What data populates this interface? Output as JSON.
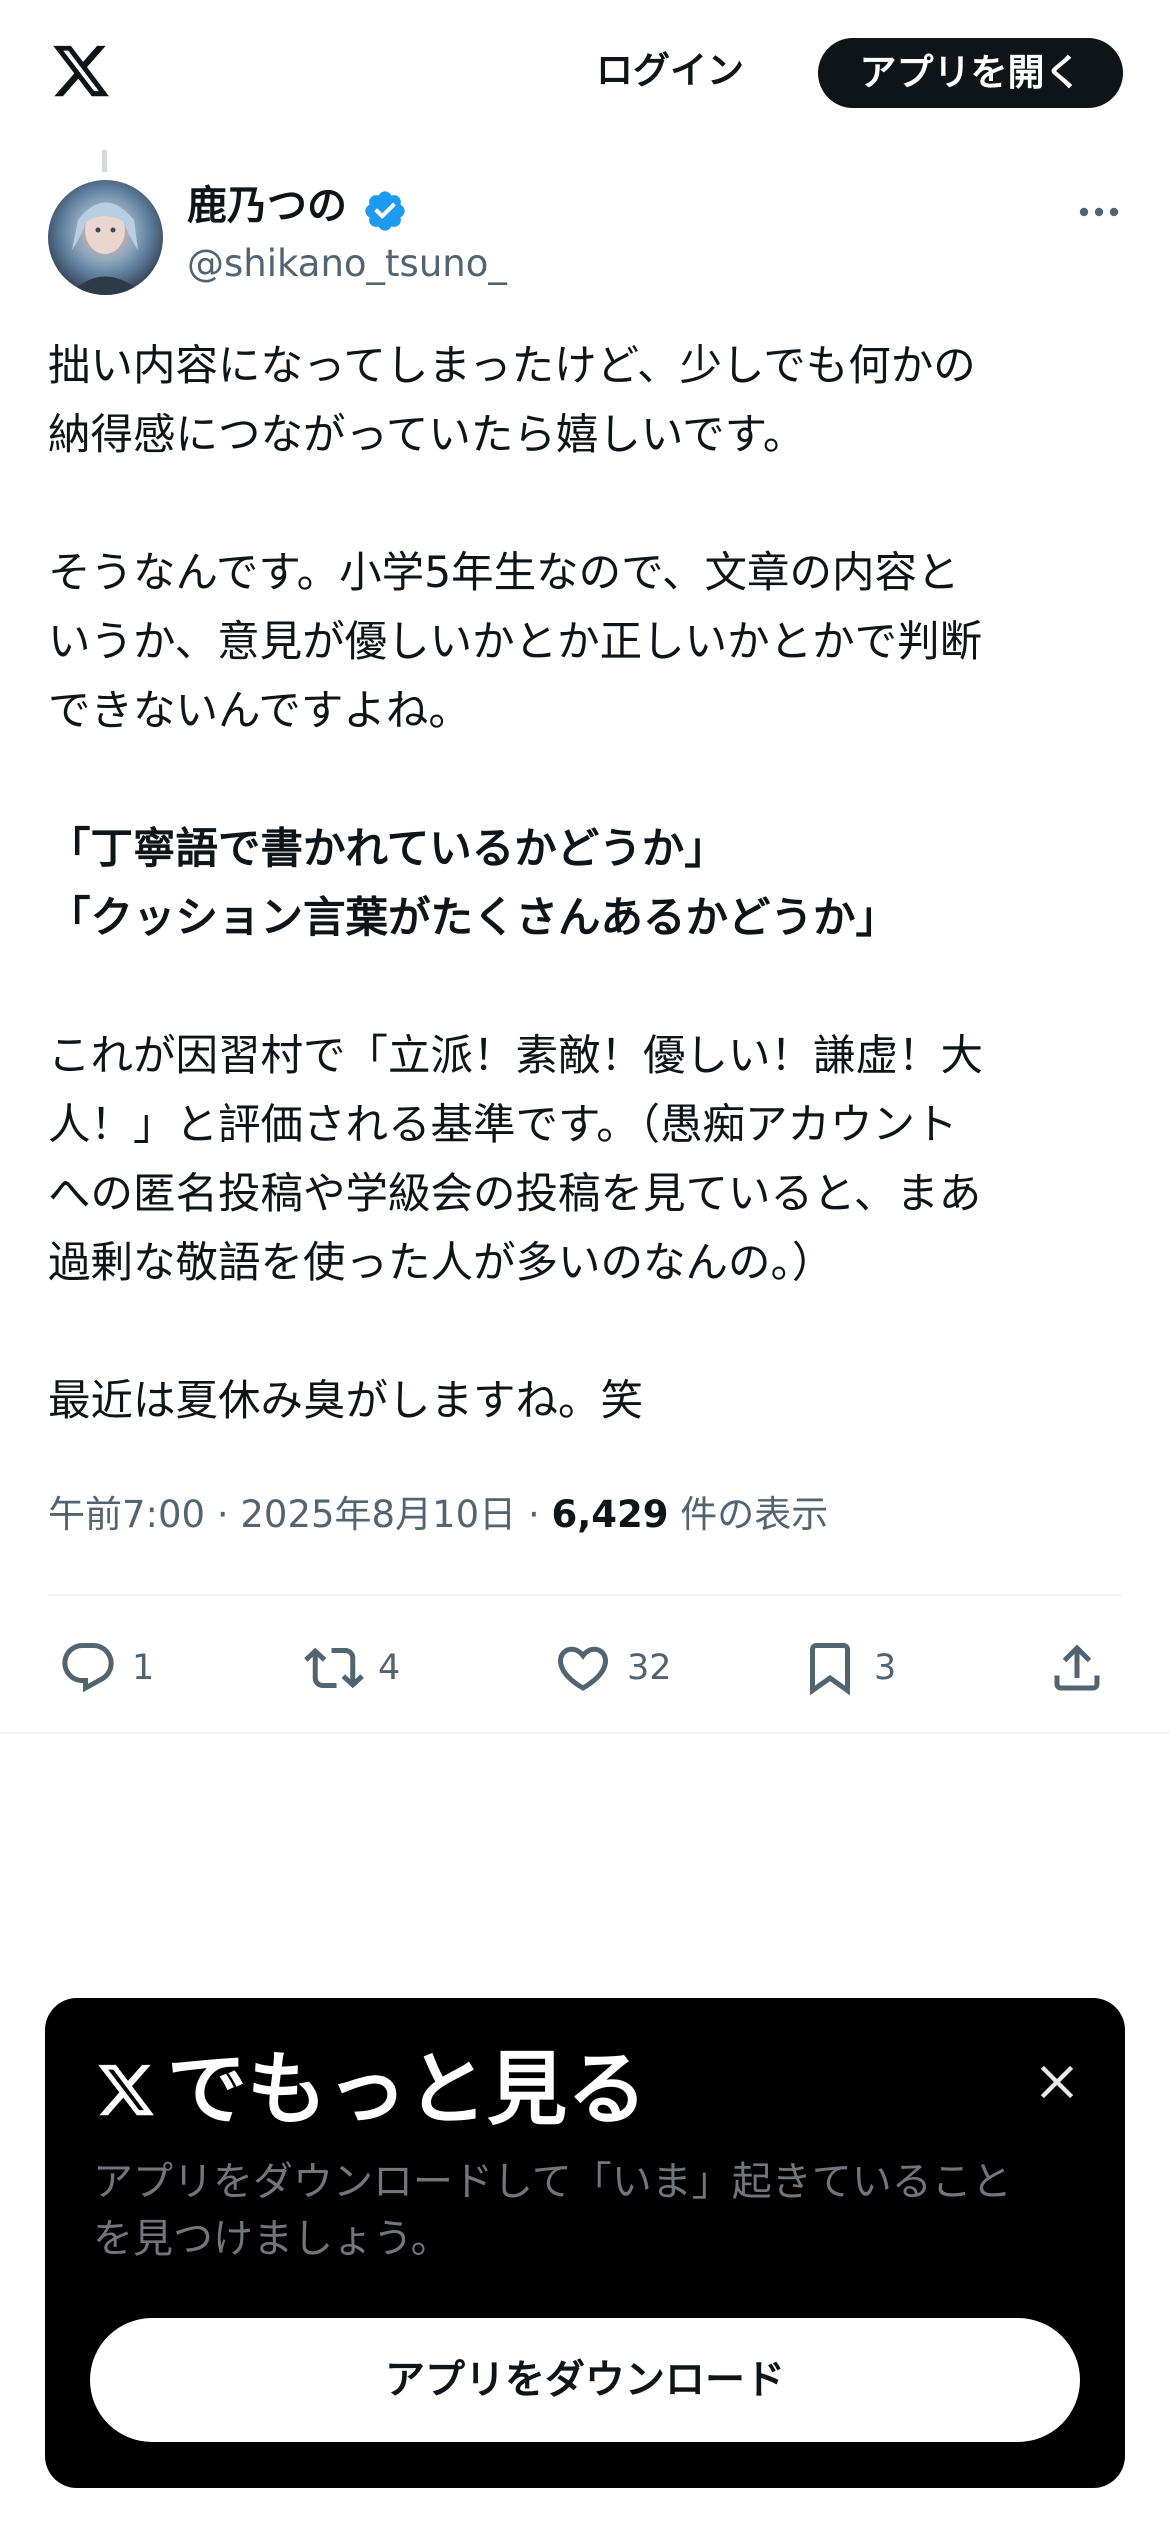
{
  "header": {
    "logo": "x-logo",
    "login_label": "ログイン",
    "open_app_label": "アプリを開く"
  },
  "tweet": {
    "author": {
      "display_name": "鹿乃つの",
      "handle": "@shikano_tsuno_",
      "verified": true,
      "avatar": "avatar"
    },
    "lines": [
      "拙い内容になってしまったけど、少しでも何かの",
      "納得感につながっていたら嬉しいです。",
      "そうなんです。小学5年生なので、文章の内容と",
      "いうか、意見が優しいかとか正しいかとかで判断",
      "できないんですよね。",
      "「丁寧語で書かれているかどうか」",
      "「クッション言葉がたくさんあるかどうか」",
      "これが因習村で「立派！素敵！優しい！謙虚！大",
      "人！」と評価される基準です。（愚痴アカウント",
      "への匿名投稿や学級会の投稿を見ていると、まあ",
      "過剰な敬語を使った人が多いのなんの。）",
      "最近は夏休み臭がしますね。笑"
    ],
    "time": "午前7:00",
    "date": "2025年8月10日",
    "separator": "·",
    "views_count": "6,429",
    "views_label": "件の表示",
    "actions": {
      "reply_count": "1",
      "retweet_count": "4",
      "like_count": "32",
      "bookmark_count": "3"
    }
  },
  "banner": {
    "title": "でもっと見る",
    "subtitle_lines": [
      "アプリをダウンロードして「いま」起きていること",
      "を見つけましょう。"
    ],
    "button_label": "アプリをダウンロード"
  },
  "colors": {
    "text_primary": "#0f1419",
    "text_secondary": "#536471",
    "verified_blue": "#1d9bf0",
    "banner_bg": "#000000",
    "banner_subtext": "#71767b"
  }
}
